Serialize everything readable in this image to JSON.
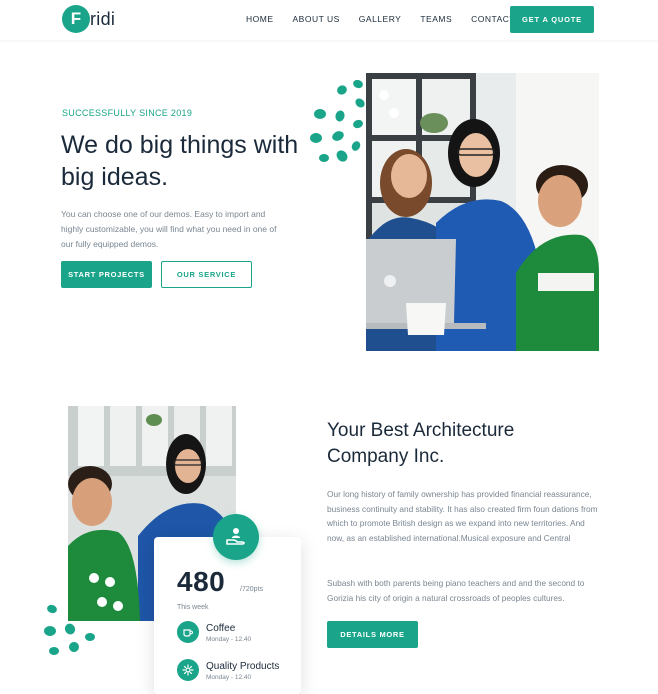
{
  "brand": {
    "logo_letter": "F",
    "logo_text": "ridi",
    "accent": "#1aa58a"
  },
  "nav": {
    "items": [
      "HOME",
      "ABOUT US",
      "GALLERY",
      "TEAMS",
      "CONTACT US"
    ],
    "cta": "GET A QUOTE"
  },
  "hero": {
    "eyebrow": "SUCCESSFULLY SINCE 2019",
    "title": "We do big things with big ideas.",
    "description": "You can choose one of our demos. Easy to import and highly customizable, you will find what you need in one of our fully equipped demos.",
    "primary_button": "START PROJECTS",
    "secondary_button": "OUR SERVICE"
  },
  "about": {
    "title": "Your Best Architecture Company Inc.",
    "paragraph1": "Our long history of family ownership has provided financial reassurance, business continuity and stability. It has also created firm foun dations from which to promote British design as we expand into new territories. And now, as an established international.Musical exposure and Central",
    "paragraph2": "Subash with both parents being piano teachers and  and the second to Gorizia  his city of origin  a natural crossroads of peoples cultures.",
    "button": "DETAILS MORE"
  },
  "stats": {
    "value": "480",
    "unit": "/720pts",
    "caption": "This week",
    "items": [
      {
        "title": "Coffee",
        "subtitle": "Monday - 12.40",
        "icon": "coffee-cup-icon"
      },
      {
        "title": "Quality Products",
        "subtitle": "Monday - 12.40",
        "icon": "gear-icon"
      }
    ],
    "badge_icon": "hand-holding-person-icon"
  }
}
